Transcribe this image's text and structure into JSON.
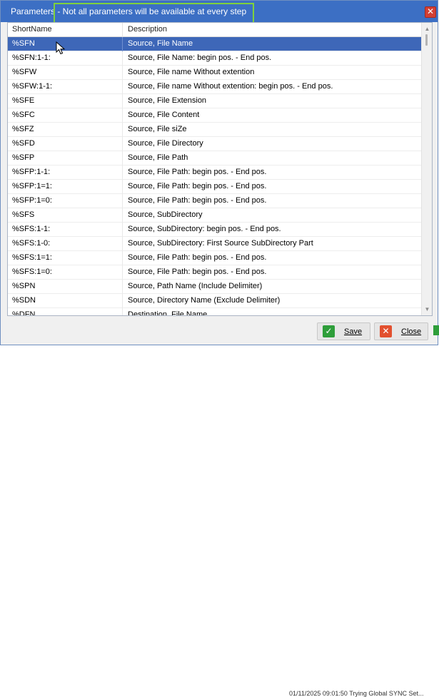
{
  "window": {
    "title": "Parameters - Not all parameters will be available at every step",
    "close_glyph": "✕",
    "accent_color": "#3c6fc4",
    "highlight_color": "#7fd23b"
  },
  "list": {
    "columns": [
      "ShortName",
      "Description"
    ],
    "selected_index": 0,
    "rows": [
      {
        "short": "%SFN",
        "desc": "Source, File Name"
      },
      {
        "short": "%SFN:1-1:",
        "desc": "Source, File Name: begin pos. - End pos."
      },
      {
        "short": "%SFW",
        "desc": "Source, File name Without extention"
      },
      {
        "short": "%SFW:1-1:",
        "desc": "Source, File name Without extention: begin pos. - End pos."
      },
      {
        "short": "%SFE",
        "desc": "Source, File Extension"
      },
      {
        "short": "%SFC",
        "desc": "Source, File Content"
      },
      {
        "short": "%SFZ",
        "desc": "Source, File siZe"
      },
      {
        "short": "%SFD",
        "desc": "Source, File Directory"
      },
      {
        "short": "%SFP",
        "desc": "Source, File Path"
      },
      {
        "short": "%SFP:1-1:",
        "desc": "Source, File Path: begin pos. - End pos."
      },
      {
        "short": "%SFP:1=1:",
        "desc": "Source, File Path: begin pos. - End pos."
      },
      {
        "short": "%SFP:1=0:",
        "desc": "Source, File Path: begin pos. - End pos."
      },
      {
        "short": "%SFS",
        "desc": "Source, SubDirectory"
      },
      {
        "short": "%SFS:1-1:",
        "desc": "Source, SubDirectory: begin pos. - End pos."
      },
      {
        "short": "%SFS:1-0:",
        "desc": "Source, SubDirectory: First Source SubDirectory Part"
      },
      {
        "short": "%SFS:1=1:",
        "desc": "Source, File Path: begin pos. - End pos."
      },
      {
        "short": "%SFS:1=0:",
        "desc": "Source, File Path: begin pos. - End pos."
      },
      {
        "short": "%SPN",
        "desc": "Source, Path Name (Include Delimiter)"
      },
      {
        "short": "%SDN",
        "desc": "Source, Directory Name (Exclude Delimiter)"
      },
      {
        "short": "%DFN",
        "desc": "Destination, File Name"
      }
    ]
  },
  "footer": {
    "save_label": "Save",
    "close_label": "Close",
    "save_icon": "check-icon",
    "close_icon": "x-icon"
  },
  "background": {
    "partial_text": "01/11/2025 09:01:50 Trying Global SYNC Set..."
  }
}
